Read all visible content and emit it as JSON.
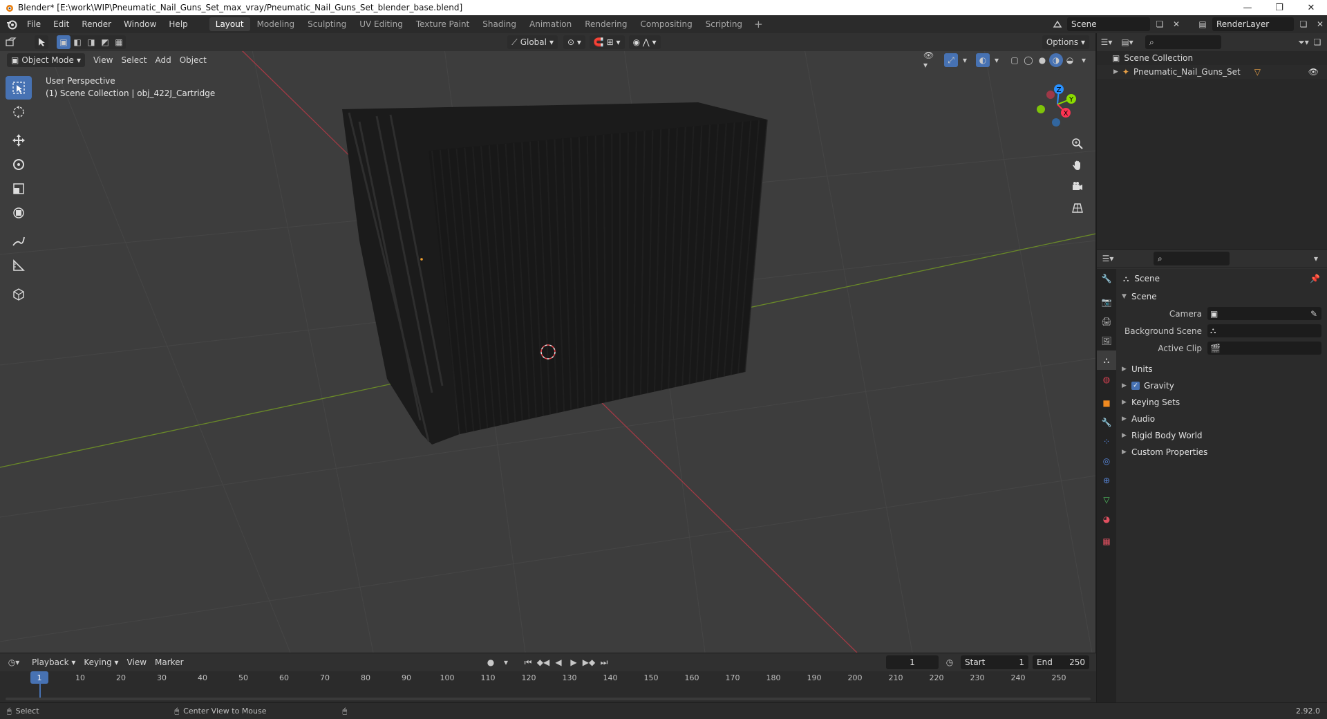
{
  "window": {
    "title": "Blender* [E:\\work\\WIP\\Pneumatic_Nail_Guns_Set_max_vray/Pneumatic_Nail_Guns_Set_blender_base.blend]",
    "minimize": "—",
    "restore": "❐",
    "close": "✕"
  },
  "menu": [
    "File",
    "Edit",
    "Render",
    "Window",
    "Help"
  ],
  "workspaces": [
    {
      "label": "Layout",
      "active": true
    },
    {
      "label": "Modeling"
    },
    {
      "label": "Sculpting"
    },
    {
      "label": "UV Editing"
    },
    {
      "label": "Texture Paint"
    },
    {
      "label": "Shading"
    },
    {
      "label": "Animation"
    },
    {
      "label": "Rendering"
    },
    {
      "label": "Compositing"
    },
    {
      "label": "Scripting"
    }
  ],
  "scene_field": "Scene",
  "renderlayer_field": "RenderLayer",
  "viewport": {
    "transform_orientation": "Global",
    "options": "Options",
    "mode": "Object Mode",
    "menus": [
      "View",
      "Select",
      "Add",
      "Object"
    ],
    "info_line1": "User Perspective",
    "info_line2": "(1) Scene Collection | obj_422J_Cartridge",
    "axis_x": "X",
    "axis_y": "Y",
    "axis_z": "Z"
  },
  "outliner": {
    "root": "Scene Collection",
    "items": [
      {
        "label": "Pneumatic_Nail_Guns_Set"
      }
    ]
  },
  "properties": {
    "context_title": "Scene",
    "panel_scene": "Scene",
    "camera_label": "Camera",
    "bg_scene_label": "Background Scene",
    "active_clip_label": "Active Clip",
    "panels": [
      "Units",
      "Gravity",
      "Keying Sets",
      "Audio",
      "Rigid Body World",
      "Custom Properties"
    ],
    "gravity_checked": true
  },
  "timeline": {
    "menus": [
      "Playback",
      "Keying",
      "View",
      "Marker"
    ],
    "current_frame": "1",
    "start_label": "Start",
    "start_value": "1",
    "end_label": "End",
    "end_value": "250",
    "ticks": [
      "1",
      "10",
      "20",
      "30",
      "40",
      "50",
      "60",
      "70",
      "80",
      "90",
      "100",
      "110",
      "120",
      "130",
      "140",
      "150",
      "160",
      "170",
      "180",
      "190",
      "200",
      "210",
      "220",
      "230",
      "240",
      "250"
    ]
  },
  "statusbar": {
    "left": "Select",
    "middle": "Center View to Mouse",
    "version": "2.92.0"
  },
  "colors": {
    "accent": "#4772b3",
    "x_axis": "#ff3352",
    "y_axis": "#8bdc00",
    "z_axis": "#2890ff",
    "viewport_bg": "#3d3d3d"
  }
}
